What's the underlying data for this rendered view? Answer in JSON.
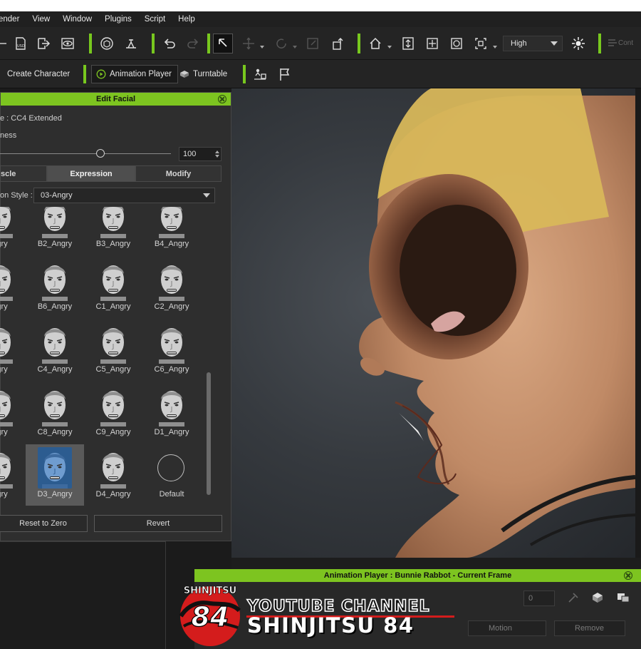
{
  "menubar": {
    "items": [
      "ender",
      "View",
      "Window",
      "Plugins",
      "Script",
      "Help"
    ]
  },
  "toolbar": {
    "quality_value": "High",
    "content_label": "Cont"
  },
  "toolbar2": {
    "create_character": "Create Character",
    "animation_player": "Animation Player",
    "turntable": "Turntable"
  },
  "edit_facial": {
    "title": "Edit Facial",
    "profile_text": "e : CC4 Extended",
    "strength_label": "ness",
    "strength_value": "100",
    "tabs": [
      "scle",
      "Expression",
      "Modify"
    ],
    "style_label": "on Style :",
    "style_value": "03-Angry",
    "expressions": [
      {
        "label": "ngry"
      },
      {
        "label": "B2_Angry"
      },
      {
        "label": "B3_Angry"
      },
      {
        "label": "B4_Angry"
      },
      {
        "label": "ngry"
      },
      {
        "label": "B6_Angry"
      },
      {
        "label": "C1_Angry"
      },
      {
        "label": "C2_Angry"
      },
      {
        "label": "ngry"
      },
      {
        "label": "C4_Angry"
      },
      {
        "label": "C5_Angry"
      },
      {
        "label": "C6_Angry"
      },
      {
        "label": "ngry"
      },
      {
        "label": "C8_Angry"
      },
      {
        "label": "C9_Angry"
      },
      {
        "label": "D1_Angry"
      },
      {
        "label": "ngry"
      },
      {
        "label": "D3_Angry"
      },
      {
        "label": "D4_Angry"
      },
      {
        "label": "Default"
      }
    ],
    "selected_expression": "D3_Angry",
    "reset_button": "Reset to Zero",
    "revert_button": "Revert"
  },
  "animation_player": {
    "title": "Animation Player : Bunnie Rabbot - Current Frame",
    "frame_value": "0",
    "motion_label": "Motion",
    "remove_label": "Remove"
  },
  "watermark": {
    "line1": "YOUTUBE CHANNEL",
    "line2": "SHINJITSU 84",
    "logo_top": "SHINJITSU",
    "logo_num": "84"
  },
  "colors": {
    "accent_green": "#7dc420",
    "panel_bg": "#2e2e2e",
    "watermark_red": "#d41c1c"
  }
}
